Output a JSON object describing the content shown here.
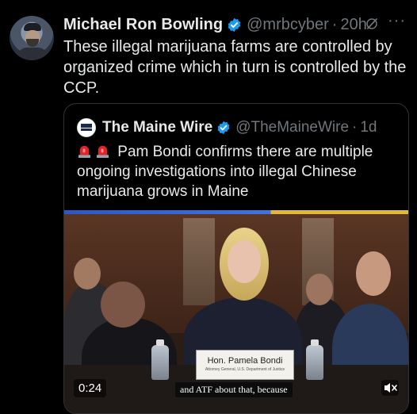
{
  "tweet": {
    "author_name": "Michael Ron Bowling",
    "handle": "@mrbcyber",
    "separator": "·",
    "time": "20h",
    "more_label": "···",
    "text": "These illegal marijuana farms are controlled by organized crime which in turn is controlled by the CCP."
  },
  "quote": {
    "author_name": "The Maine Wire",
    "handle": "@TheMaineWire",
    "separator": "·",
    "time": "1d",
    "text": "Pam Bondi confirms there are multiple ongoing investigations into illegal Chinese marijuana grows in Maine",
    "emoji_icons": [
      "siren-icon",
      "siren-icon"
    ],
    "video": {
      "duration": "0:24",
      "caption": "and ATF about that, because",
      "nameplate_name": "Hon. Pamela Bondi",
      "nameplate_sub": "Attorney General, U.S. Department of Justice"
    }
  },
  "colors": {
    "verified": "#1d9bf0",
    "text_primary": "#e7e9ea",
    "text_secondary": "#71767b",
    "border": "#2f3336"
  },
  "icons": [
    "verified-badge-icon",
    "grok-icon",
    "more-icon",
    "mute-icon"
  ]
}
